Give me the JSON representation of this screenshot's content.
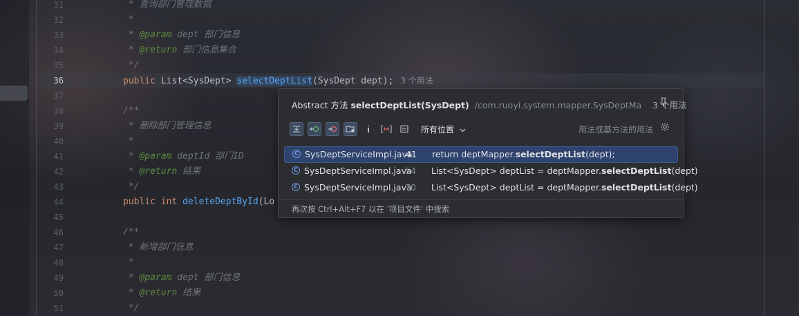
{
  "editor": {
    "lines": [
      {
        "n": "31",
        "text": " * 查询部门管理数据"
      },
      {
        "n": "32",
        "text": " *"
      },
      {
        "n": "33",
        "tag": "@param",
        "name": "dept",
        "desc": "部门信息"
      },
      {
        "n": "34",
        "tag": "@return",
        "desc": "部门信息集合"
      },
      {
        "n": "35",
        "text": " */"
      },
      {
        "n": "36",
        "kw": "public",
        "type": "List<SysDept>",
        "fn": "selectDeptList",
        "args": "(SysDept dept);",
        "hint": "3 个用法"
      },
      {
        "n": "37",
        "text": ""
      },
      {
        "n": "38",
        "text": "/**"
      },
      {
        "n": "39",
        "text": " * 删除部门管理信息"
      },
      {
        "n": "40",
        "text": " *"
      },
      {
        "n": "41",
        "tag": "@param",
        "name": "deptId",
        "desc": "部门ID"
      },
      {
        "n": "42",
        "tag": "@return",
        "desc": "结果"
      },
      {
        "n": "43",
        "text": " */"
      },
      {
        "n": "44",
        "kw": "public",
        "type": "int",
        "fn": "deleteDeptById",
        "args": "(Lo"
      },
      {
        "n": "45",
        "text": ""
      },
      {
        "n": "46",
        "text": "/**"
      },
      {
        "n": "47",
        "text": " * 新增部门信息"
      },
      {
        "n": "48",
        "text": " *"
      },
      {
        "n": "49",
        "tag": "@param",
        "name": "dept",
        "desc": "部门信息"
      },
      {
        "n": "50",
        "tag": "@return",
        "desc": "结果"
      },
      {
        "n": "51",
        "text": " */"
      }
    ]
  },
  "popup": {
    "title_prefix": "Abstract 方法",
    "title_method": "selectDeptList(SysDept)",
    "title_path": "/com.ruoyi.system.mapper.SysDeptMa",
    "title_uses": "3 个用法",
    "scope": "所有位置",
    "scope_note": "用法或基方法的用法",
    "results": [
      {
        "file": "SysDeptServiceImpl.java",
        "line": "41",
        "pre": "return deptMapper.",
        "bold": "selectDeptList",
        "post": "(dept);",
        "selected": true
      },
      {
        "file": "SysDeptServiceImpl.java",
        "line": "54",
        "pre": "List<SysDept> deptList = deptMapper.",
        "bold": "selectDeptList",
        "post": "(dept)",
        "selected": false
      },
      {
        "file": "SysDeptServiceImpl.java",
        "line": "70",
        "pre": "List<SysDept> deptList = deptMapper.",
        "bold": "selectDeptList",
        "post": "(dept)",
        "selected": false
      }
    ],
    "footer": "再次按 Ctrl+Alt+F7 以在 '项目文件' 中搜索"
  },
  "icons": {
    "pin": "pin-icon",
    "gear": "gear-icon",
    "class": "class-icon"
  },
  "colors": {
    "selection": "#2e436e",
    "keyword": "#cf8e6d",
    "function": "#56a8f5",
    "doc_tag": "#5f8c3f"
  }
}
